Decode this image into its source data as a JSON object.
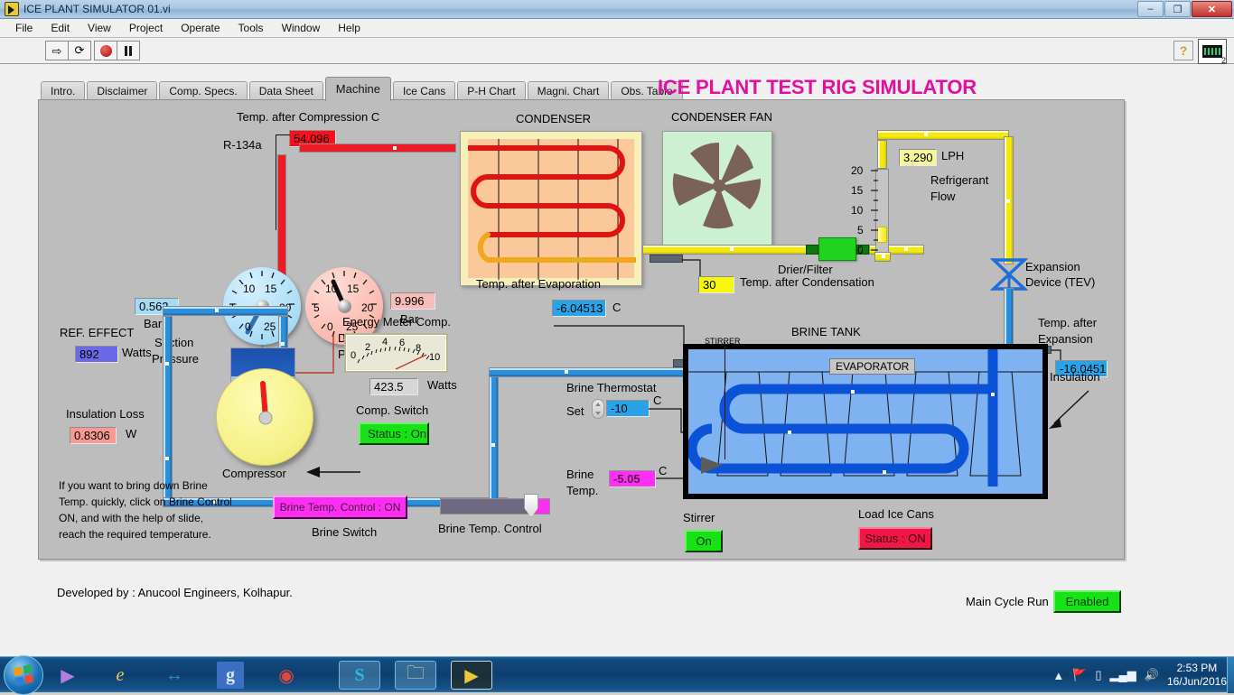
{
  "window": {
    "title": "ICE PLANT SIMULATOR 01.vi",
    "icon": "labview-vi-icon",
    "minimize": "–",
    "maximize": "❐",
    "close": "✕"
  },
  "menu": [
    "File",
    "Edit",
    "View",
    "Project",
    "Operate",
    "Tools",
    "Window",
    "Help"
  ],
  "toolbar": {
    "run": "run-arrow-icon",
    "run_continuous": "run-continuously-icon",
    "abort": "abort-execution-icon",
    "pause": "pause-icon",
    "help": "?",
    "lv_version": "2"
  },
  "tabs": [
    {
      "label": "Intro.",
      "active": false
    },
    {
      "label": "Disclaimer",
      "active": false
    },
    {
      "label": "Comp. Specs.",
      "active": false
    },
    {
      "label": "Data Sheet",
      "active": false
    },
    {
      "label": "Machine",
      "active": true
    },
    {
      "label": "Ice Cans",
      "active": false
    },
    {
      "label": "P-H Chart",
      "active": false
    },
    {
      "label": "Magni. Chart",
      "active": false
    },
    {
      "label": "Obs. Table",
      "active": false
    }
  ],
  "app_title": "ICE PLANT TEST RIG SIMULATOR",
  "diagram": {
    "refrigerant_label": "R-134a",
    "temp_after_compression_label": "Temp. after Compression  C",
    "temp_after_compression_value": "54.096",
    "suction_pressure_label_l1": "Suction",
    "suction_pressure_label_l2": "Pressure",
    "suction_pressure_value": "0.562",
    "suction_pressure_unit": "Bar",
    "suction_gauge_ticks": [
      "0",
      "5",
      "10",
      "15",
      "20",
      "25"
    ],
    "discharge_pressure_label_l1": "Discharge",
    "discharge_pressure_label_l2": "Pressure",
    "discharge_pressure_value": "9.996",
    "discharge_pressure_unit": "Bar",
    "discharge_gauge_ticks": [
      "0",
      "5",
      "10",
      "15",
      "20",
      "25"
    ],
    "condenser_label": "CONDENSER",
    "condenser_fan_label": "CONDENSER FAN",
    "drier_filter_label": "Drier/Filter",
    "temp_after_condensation_label": "Temp. after Condensation",
    "temp_after_condensation_value": "30",
    "temp_after_evaporation_label": "Temp. after Evaporation",
    "temp_after_evaporation_value": "-6.04513",
    "temp_after_evaporation_unit": "C",
    "refrigerant_flow_label_l1": "Refrigerant",
    "refrigerant_flow_label_l2": "Flow",
    "refrigerant_flow_value": "3.290",
    "refrigerant_flow_unit": "LPH",
    "refrigerant_flow_ticks": [
      "20",
      "15",
      "10",
      "5",
      "0"
    ],
    "expansion_device_label_l1": "Expansion",
    "expansion_device_label_l2": "Device (TEV)",
    "temp_after_expansion_label_l1": "Temp. after",
    "temp_after_expansion_label_l2": "Expansion",
    "temp_after_expansion_value": "-16.0451",
    "ref_effect_label": "REF. EFFECT",
    "ref_effect_value": "892",
    "ref_effect_unit": "Watts",
    "insulation_loss_label": "Insulation Loss",
    "insulation_loss_value": "0.8306",
    "insulation_loss_unit": "W",
    "compressor_label": "Compressor",
    "energy_meter_label": "Energy Meter Comp.",
    "energy_meter_ticks": [
      "0",
      "2",
      "4",
      "6",
      "8",
      "10"
    ],
    "energy_meter_value": "423.5",
    "energy_meter_unit": "Watts",
    "comp_switch_label": "Comp. Switch",
    "comp_switch_status": "Status : On",
    "brine_thermostat_label": "Brine Thermostat",
    "brine_set_label": "Set",
    "brine_set_value": "-10",
    "brine_set_unit": "C",
    "brine_temp_label_l1": "Brine",
    "brine_temp_label_l2": "Temp.",
    "brine_temp_value": "-5.05",
    "brine_temp_unit": "C",
    "brine_tank_label": "BRINE TANK",
    "stirrer_tank_label": "STIRRER",
    "evaporator_label": "EVAPORATOR",
    "insulation_label": "Insulation",
    "hint_l1": "If you want to bring down Brine",
    "hint_l2": "Temp. quickly, click on Brine  Control",
    "hint_l3": "ON, and with the help of slide,",
    "hint_l4": "reach the required temperature.",
    "brine_control_button": "Brine Temp. Control : ON",
    "brine_switch_label": "Brine Switch",
    "brine_temp_control_label": "Brine Temp.  Control",
    "stirrer_label": "Stirrer",
    "stirrer_status": "On",
    "load_ice_cans_label": "Load Ice Cans",
    "load_ice_cans_status": "Status : ON"
  },
  "footer": {
    "developed_by": "Developed by : Anucool Engineers, Kolhapur.",
    "main_cycle_run_label": "Main Cycle Run",
    "main_cycle_run_status": "Enabled"
  },
  "taskbar": {
    "start": "windows-start-icon",
    "apps": [
      {
        "name": "media-player-icon",
        "glyph": "▶"
      },
      {
        "name": "internet-explorer-icon",
        "glyph": "e"
      },
      {
        "name": "teamviewer-icon",
        "glyph": "↔"
      },
      {
        "name": "google-icon",
        "glyph": "g"
      },
      {
        "name": "chrome-icon",
        "glyph": "◉"
      },
      {
        "name": "skype-icon",
        "glyph": "S"
      },
      {
        "name": "explorer-icon",
        "glyph": "🗀"
      },
      {
        "name": "labview-icon",
        "glyph": "▶"
      }
    ],
    "tray": [
      "show-hidden-icons",
      "network-error-icon",
      "battery-icon",
      "signal-icon",
      "volume-icon"
    ],
    "time": "2:53 PM",
    "date": "16/Jun/2016"
  },
  "colors": {
    "accent_pink": "#e1109e",
    "status_green": "#16e216",
    "status_red": "#f11744",
    "status_magenta": "#fc2ff1",
    "pipe_blue": "#2b8fe0",
    "pipe_yellow": "#f4e90c",
    "pipe_red": "#ed1c24"
  }
}
